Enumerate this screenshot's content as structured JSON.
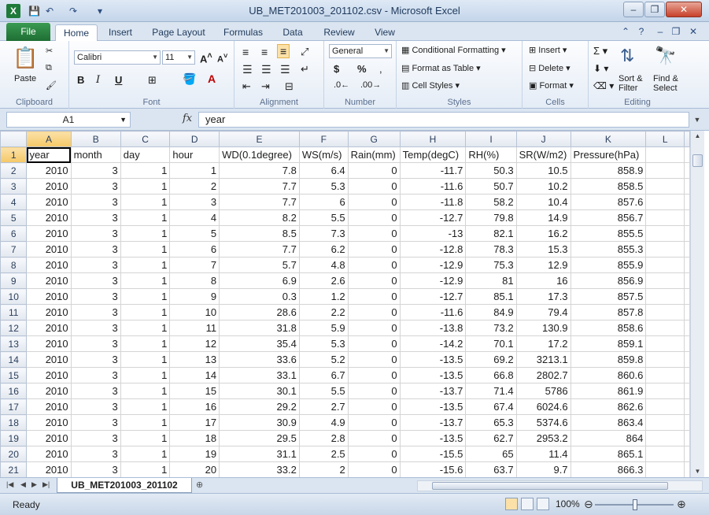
{
  "window": {
    "title": "UB_MET201003_201102.csv - Microsoft Excel",
    "app_icon_letter": "X",
    "minimize": "–",
    "restore": "❐",
    "close": "✕"
  },
  "tabs": [
    {
      "label": "File"
    },
    {
      "label": "Home"
    },
    {
      "label": "Insert"
    },
    {
      "label": "Page Layout"
    },
    {
      "label": "Formulas"
    },
    {
      "label": "Data"
    },
    {
      "label": "Review"
    },
    {
      "label": "View"
    }
  ],
  "ribbon": {
    "clipboard": {
      "label": "Clipboard",
      "paste": "Paste"
    },
    "font": {
      "label": "Font",
      "name": "Calibri",
      "size": "11",
      "bold": "B",
      "italic": "I",
      "underline": "U"
    },
    "alignment": {
      "label": "Alignment"
    },
    "number": {
      "label": "Number",
      "format": "General",
      "currency": "$",
      "percent": "%"
    },
    "styles": {
      "label": "Styles",
      "conditional": "Conditional Formatting",
      "format_table": "Format as Table",
      "cell_styles": "Cell Styles"
    },
    "cells": {
      "label": "Cells",
      "insert": "Insert",
      "delete": "Delete",
      "format": "Format"
    },
    "editing": {
      "label": "Editing",
      "sort": "Sort &",
      "filter": "Filter",
      "find": "Find &",
      "select": "Select"
    }
  },
  "formula_bar": {
    "name_box": "A1",
    "fx": "fx",
    "value": "year"
  },
  "grid": {
    "columns": [
      "A",
      "B",
      "C",
      "D",
      "E",
      "F",
      "G",
      "H",
      "I",
      "J",
      "K",
      "L"
    ],
    "header_row": [
      "year",
      "month",
      "day",
      "hour",
      "WD(0.1degree)",
      "WS(m/s)",
      "Rain(mm)",
      "Temp(degC)",
      "RH(%)",
      "SR(W/m2)",
      "Pressure(hPa)",
      ""
    ],
    "rows": [
      [
        "2010",
        "3",
        "1",
        "1",
        "7.8",
        "6.4",
        "0",
        "-11.7",
        "50.3",
        "10.5",
        "858.9"
      ],
      [
        "2010",
        "3",
        "1",
        "2",
        "7.7",
        "5.3",
        "0",
        "-11.6",
        "50.7",
        "10.2",
        "858.5"
      ],
      [
        "2010",
        "3",
        "1",
        "3",
        "7.7",
        "6",
        "0",
        "-11.8",
        "58.2",
        "10.4",
        "857.6"
      ],
      [
        "2010",
        "3",
        "1",
        "4",
        "8.2",
        "5.5",
        "0",
        "-12.7",
        "79.8",
        "14.9",
        "856.7"
      ],
      [
        "2010",
        "3",
        "1",
        "5",
        "8.5",
        "7.3",
        "0",
        "-13",
        "82.1",
        "16.2",
        "855.5"
      ],
      [
        "2010",
        "3",
        "1",
        "6",
        "7.7",
        "6.2",
        "0",
        "-12.8",
        "78.3",
        "15.3",
        "855.3"
      ],
      [
        "2010",
        "3",
        "1",
        "7",
        "5.7",
        "4.8",
        "0",
        "-12.9",
        "75.3",
        "12.9",
        "855.9"
      ],
      [
        "2010",
        "3",
        "1",
        "8",
        "6.9",
        "2.6",
        "0",
        "-12.9",
        "81",
        "16",
        "856.9"
      ],
      [
        "2010",
        "3",
        "1",
        "9",
        "0.3",
        "1.2",
        "0",
        "-12.7",
        "85.1",
        "17.3",
        "857.5"
      ],
      [
        "2010",
        "3",
        "1",
        "10",
        "28.6",
        "2.2",
        "0",
        "-11.6",
        "84.9",
        "79.4",
        "857.8"
      ],
      [
        "2010",
        "3",
        "1",
        "11",
        "31.8",
        "5.9",
        "0",
        "-13.8",
        "73.2",
        "130.9",
        "858.6"
      ],
      [
        "2010",
        "3",
        "1",
        "12",
        "35.4",
        "5.3",
        "0",
        "-14.2",
        "70.1",
        "17.2",
        "859.1"
      ],
      [
        "2010",
        "3",
        "1",
        "13",
        "33.6",
        "5.2",
        "0",
        "-13.5",
        "69.2",
        "3213.1",
        "859.8"
      ],
      [
        "2010",
        "3",
        "1",
        "14",
        "33.1",
        "6.7",
        "0",
        "-13.5",
        "66.8",
        "2802.7",
        "860.6"
      ],
      [
        "2010",
        "3",
        "1",
        "15",
        "30.1",
        "5.5",
        "0",
        "-13.7",
        "71.4",
        "5786",
        "861.9"
      ],
      [
        "2010",
        "3",
        "1",
        "16",
        "29.2",
        "2.7",
        "0",
        "-13.5",
        "67.4",
        "6024.6",
        "862.6"
      ],
      [
        "2010",
        "3",
        "1",
        "17",
        "30.9",
        "4.9",
        "0",
        "-13.7",
        "65.3",
        "5374.6",
        "863.4"
      ],
      [
        "2010",
        "3",
        "1",
        "18",
        "29.5",
        "2.8",
        "0",
        "-13.5",
        "62.7",
        "2953.2",
        "864"
      ],
      [
        "2010",
        "3",
        "1",
        "19",
        "31.1",
        "2.5",
        "0",
        "-15.5",
        "65",
        "11.4",
        "865.1"
      ],
      [
        "2010",
        "3",
        "1",
        "20",
        "33.2",
        "2",
        "0",
        "-15.6",
        "63.7",
        "9.7",
        "866.3"
      ]
    ]
  },
  "sheet_tabs": {
    "active": "UB_MET201003_201102"
  },
  "status": {
    "text": "Ready",
    "zoom": "100%"
  }
}
